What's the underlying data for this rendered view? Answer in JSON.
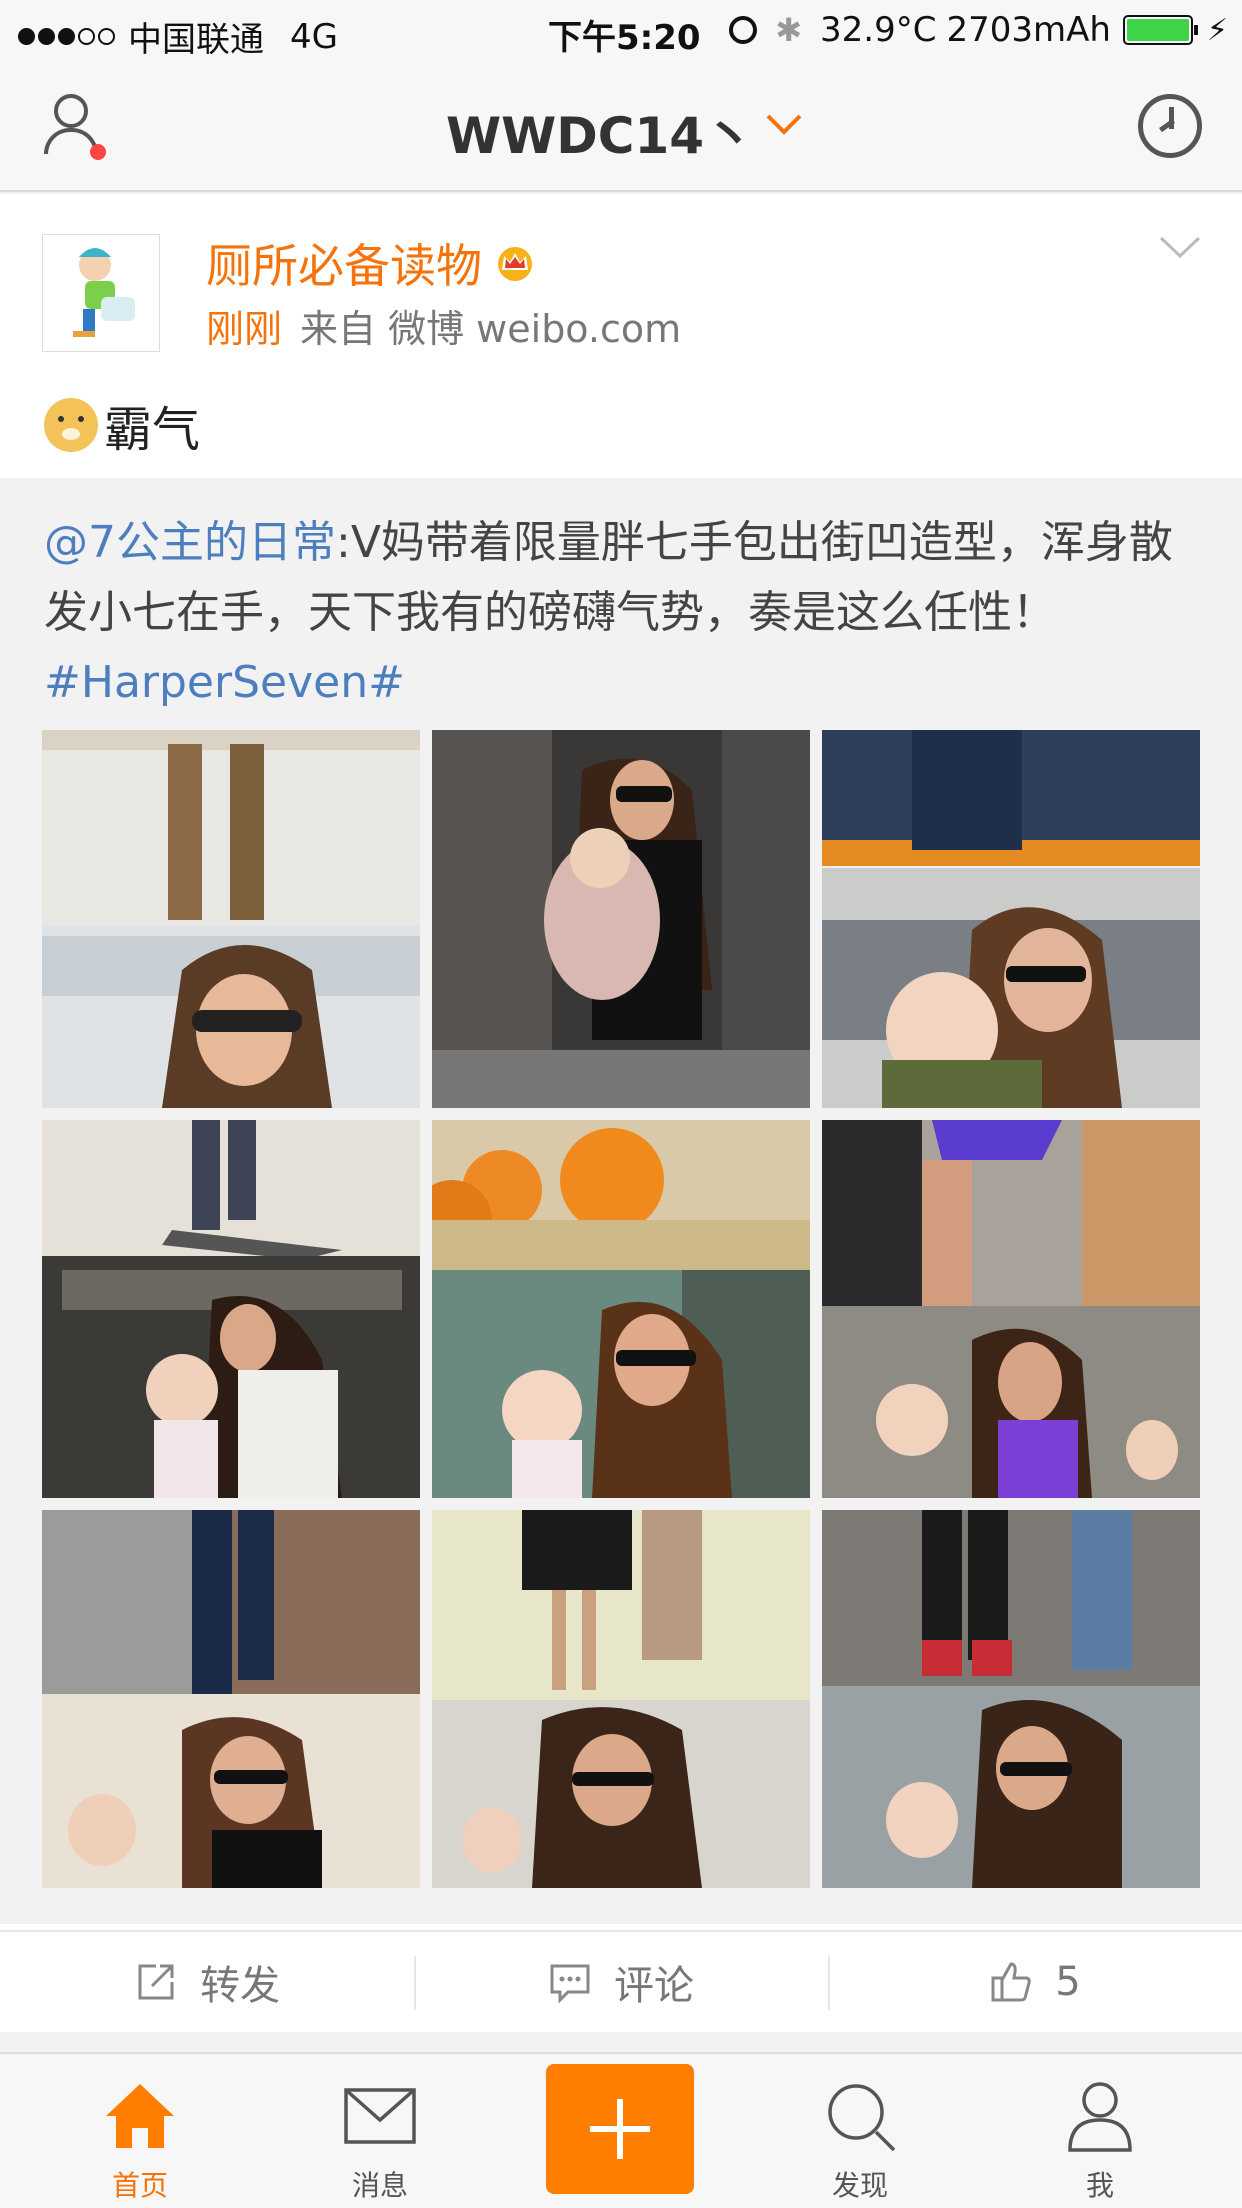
{
  "status_bar": {
    "carrier": "中国联通",
    "network": "4G",
    "time": "下午5:20",
    "temperature": "32.9°C",
    "battery": "2703mAh",
    "battery_level": 1.0
  },
  "nav": {
    "title": "WWDC14丶",
    "accent_color": "#f5730a"
  },
  "post": {
    "author": "厕所必备读物",
    "time_ago": "刚刚",
    "source": "来自 微博 weibo.com",
    "text": "霸气",
    "emoji": "doge",
    "repost": {
      "mention": "@7公主的日常",
      "body": ":V妈带着限量胖七手包出街凹造型，浑身散发小七在手，天下我有的磅礴气势，奏是这么任性！",
      "hashtag": "#HarperSeven#",
      "image_count": 9
    }
  },
  "actions": {
    "repost_label": "转发",
    "comment_label": "评论",
    "like_count": "5"
  },
  "tabs": {
    "home": "首页",
    "messages": "消息",
    "discover": "发现",
    "me": "我",
    "active": "home"
  }
}
